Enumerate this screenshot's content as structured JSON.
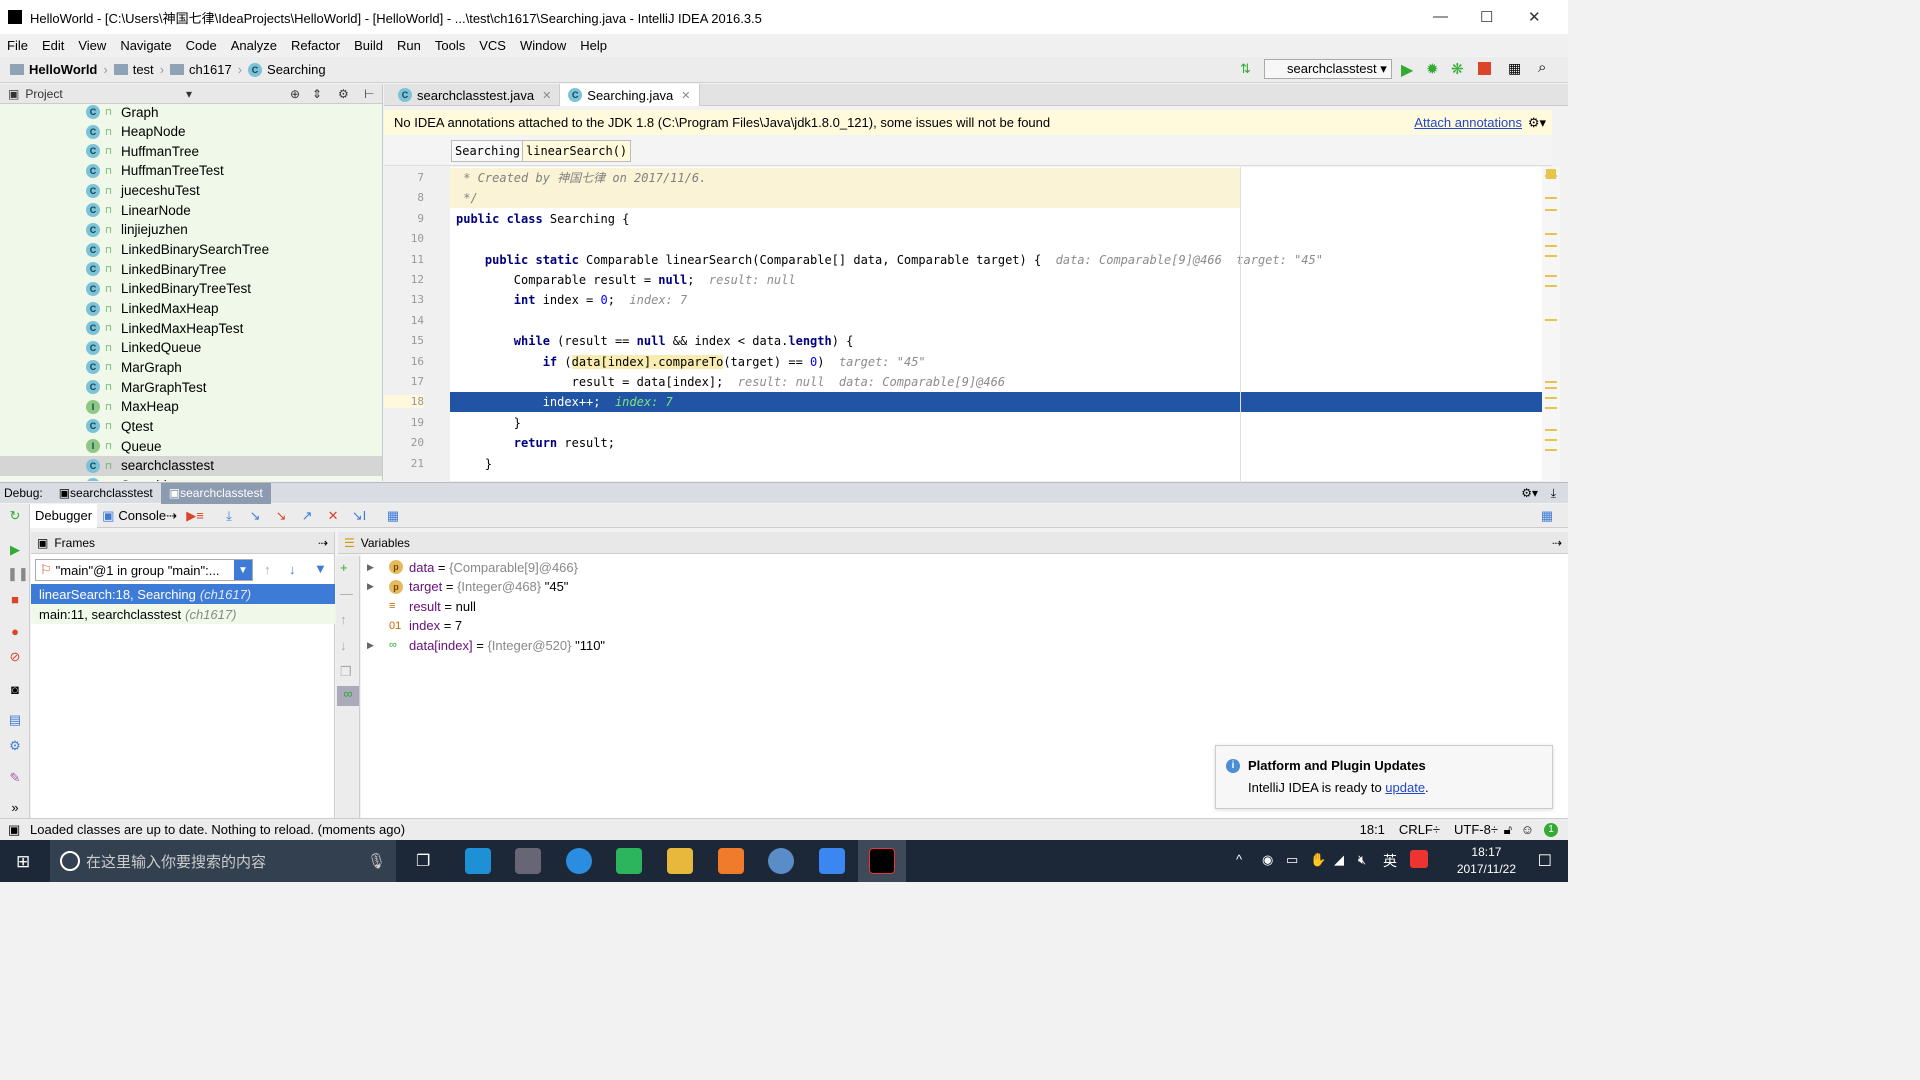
{
  "window": {
    "title": "HelloWorld - [C:\\Users\\神国七律\\IdeaProjects\\HelloWorld] - [HelloWorld] - ...\\test\\ch1617\\Searching.java - IntelliJ IDEA 2016.3.5"
  },
  "menu": [
    "File",
    "Edit",
    "View",
    "Navigate",
    "Code",
    "Analyze",
    "Refactor",
    "Build",
    "Run",
    "Tools",
    "VCS",
    "Window",
    "Help"
  ],
  "breadcrumb": [
    "HelloWorld",
    "test",
    "ch1617",
    "Searching"
  ],
  "run_config": "searchclasstest",
  "project": {
    "header": "Project",
    "items": [
      {
        "name": "Graph",
        "kind": "C"
      },
      {
        "name": "HeapNode",
        "kind": "C"
      },
      {
        "name": "HuffmanTree",
        "kind": "C"
      },
      {
        "name": "HuffmanTreeTest",
        "kind": "C"
      },
      {
        "name": "jueceshuTest",
        "kind": "C"
      },
      {
        "name": "LinearNode",
        "kind": "C"
      },
      {
        "name": "linjiejuzhen",
        "kind": "C"
      },
      {
        "name": "LinkedBinarySearchTree",
        "kind": "C"
      },
      {
        "name": "LinkedBinaryTree",
        "kind": "C"
      },
      {
        "name": "LinkedBinaryTreeTest",
        "kind": "C"
      },
      {
        "name": "LinkedMaxHeap",
        "kind": "C"
      },
      {
        "name": "LinkedMaxHeapTest",
        "kind": "C"
      },
      {
        "name": "LinkedQueue",
        "kind": "C"
      },
      {
        "name": "MarGraph",
        "kind": "C"
      },
      {
        "name": "MarGraphTest",
        "kind": "C"
      },
      {
        "name": "MaxHeap",
        "kind": "I"
      },
      {
        "name": "Qtest",
        "kind": "C"
      },
      {
        "name": "Queue",
        "kind": "I"
      },
      {
        "name": "searchclasstest",
        "kind": "C",
        "selected": true
      },
      {
        "name": "Searching",
        "kind": "C"
      }
    ]
  },
  "editor": {
    "tabs": [
      {
        "label": "searchclasstest.java",
        "active": false
      },
      {
        "label": "Searching.java",
        "active": true
      }
    ],
    "annotation": {
      "text": "No IDEA annotations attached to the JDK 1.8 (C:\\Program Files\\Java\\jdk1.8.0_121), some issues will not be found",
      "link": "Attach annotations"
    },
    "breadcrumbs": [
      "Searching",
      "linearSearch()"
    ],
    "current_line": 18,
    "lines": [
      {
        "n": "7",
        "tokens": [
          [
            " * Created by 神国七律 on 2017/11/6.",
            "cm"
          ]
        ],
        "style": "cmt"
      },
      {
        "n": "8",
        "tokens": [
          [
            " */",
            "cm"
          ]
        ],
        "style": "cmt"
      },
      {
        "n": "9",
        "tokens": [
          [
            "public class ",
            "kw"
          ],
          [
            "Searching {",
            ""
          ]
        ]
      },
      {
        "n": "10",
        "tokens": []
      },
      {
        "n": "11",
        "tokens": [
          [
            "    public static ",
            "kw"
          ],
          [
            "Comparable linearSearch(Comparable[] data, Comparable target) {  ",
            ""
          ],
          [
            "data: Comparable[9]@466  target: \"45\"",
            "hint"
          ]
        ]
      },
      {
        "n": "12",
        "tokens": [
          [
            "        Comparable result = ",
            ""
          ],
          [
            "null",
            "kw"
          ],
          [
            ";  ",
            ""
          ],
          [
            "result: null",
            "hint"
          ]
        ]
      },
      {
        "n": "13",
        "tokens": [
          [
            "        int ",
            "kw"
          ],
          [
            "index = ",
            ""
          ],
          [
            "0",
            "num"
          ],
          [
            ";  ",
            ""
          ],
          [
            "index: 7",
            "hint"
          ]
        ]
      },
      {
        "n": "14",
        "tokens": []
      },
      {
        "n": "15",
        "tokens": [
          [
            "        while ",
            "kw"
          ],
          [
            "(result == ",
            ""
          ],
          [
            "null",
            "kw"
          ],
          [
            " && index < data.",
            ""
          ],
          [
            "length",
            "kw"
          ],
          [
            ") {",
            ""
          ]
        ]
      },
      {
        "n": "16",
        "tokens": [
          [
            "            if ",
            "kw"
          ],
          [
            "(",
            ""
          ],
          [
            "data[index].compareTo",
            "hl"
          ],
          [
            "(target) == ",
            ""
          ],
          [
            "0",
            "num"
          ],
          [
            ")  ",
            ""
          ],
          [
            "target: \"45\"",
            "hint"
          ]
        ]
      },
      {
        "n": "17",
        "tokens": [
          [
            "                result = data[index];  ",
            ""
          ],
          [
            "result: null  data: Comparable[9]@466",
            "hint"
          ]
        ]
      },
      {
        "n": "18",
        "tokens": [
          [
            "            index++;  ",
            ""
          ],
          [
            "index: 7",
            "hint"
          ]
        ],
        "style": "cur"
      },
      {
        "n": "19",
        "tokens": [
          [
            "        }",
            ""
          ]
        ]
      },
      {
        "n": "20",
        "tokens": [
          [
            "        return ",
            "kw"
          ],
          [
            "result;",
            ""
          ]
        ]
      },
      {
        "n": "21",
        "tokens": [
          [
            "    }",
            ""
          ]
        ]
      }
    ]
  },
  "debug": {
    "label": "Debug:",
    "sessions": [
      {
        "label": "searchclasstest",
        "active": false
      },
      {
        "label": "searchclasstest",
        "active": true
      }
    ],
    "tabs": [
      "Debugger",
      "Console"
    ],
    "frames_header": "Frames",
    "thread": "\"main\"@1 in group \"main\":...",
    "frames": [
      {
        "method": "linearSearch:18, Searching",
        "pkg": "(ch1617)",
        "selected": true
      },
      {
        "method": "main:11, searchclasstest",
        "pkg": "(ch1617)"
      }
    ],
    "variables_header": "Variables",
    "variables": [
      {
        "name": "data",
        "eq": " = ",
        "type": "{Comparable[9]@466}",
        "value": "",
        "expandable": true,
        "icon": "param-icon"
      },
      {
        "name": "target",
        "eq": " = ",
        "type": "{Integer@468}",
        "value": " \"45\"",
        "expandable": true,
        "icon": "param-icon"
      },
      {
        "name": "result",
        "eq": " = ",
        "type": "",
        "value": "null",
        "expandable": false,
        "icon": "field-icon"
      },
      {
        "name": "index",
        "eq": " = ",
        "type": "",
        "value": "7",
        "expandable": false,
        "icon": "primitive-icon"
      },
      {
        "name": "data[index]",
        "eq": " = ",
        "type": "{Integer@520}",
        "value": " \"110\"",
        "expandable": true,
        "icon": "watch-icon"
      }
    ]
  },
  "notification": {
    "title": "Platform and Plugin Updates",
    "body": "IntelliJ IDEA is ready to ",
    "link": "update",
    "tail": "."
  },
  "status": {
    "message": "Loaded classes are up to date. Nothing to reload. (moments ago)",
    "position": "18:1",
    "line_sep": "CRLF",
    "encoding": "UTF-8"
  },
  "taskbar": {
    "search_placeholder": "在这里输入你要搜索的内容",
    "time": "18:17",
    "date": "2017/11/22",
    "ime": "英"
  },
  "colors": {
    "selection": "#2154a5",
    "frame_selected": "#3e7bd6",
    "annotation_bg": "#fffadc",
    "project_bg": "#f0f9e9"
  }
}
